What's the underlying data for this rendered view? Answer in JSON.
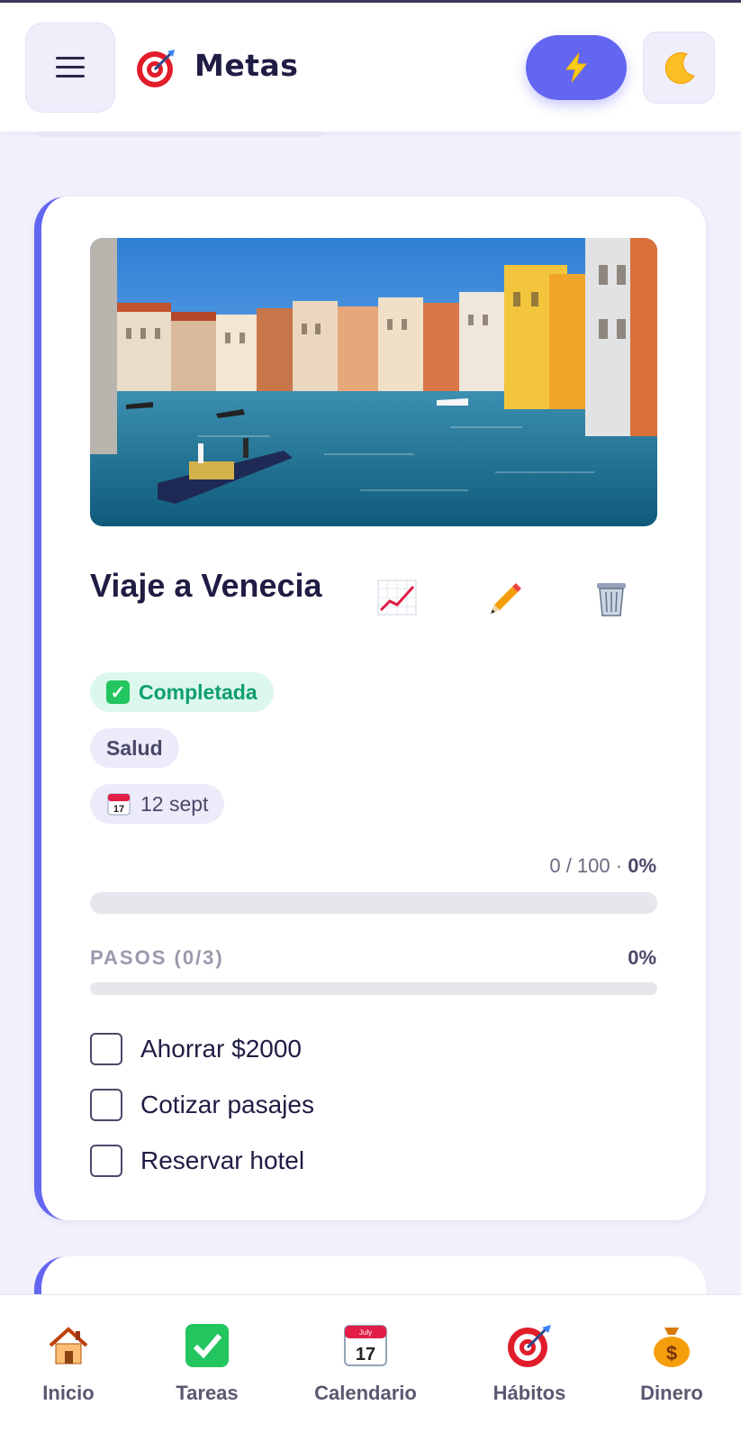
{
  "app": {
    "title": "Metas"
  },
  "header": {
    "menu_icon": "hamburger-icon",
    "logo_icon": "target-icon",
    "quick_icon": "lightning-icon",
    "theme_icon": "moon-icon"
  },
  "goal": {
    "title": "Viaje a Venecia",
    "image": "venice-canal-photo",
    "status": "Completada",
    "category": "Salud",
    "date": "12 sept",
    "progress_text": "0 / 100 · ",
    "progress_pct": "0%",
    "progress_value": 0,
    "steps_label": "PASOS (0/3)",
    "steps_pct": "0%",
    "steps_value": 0,
    "steps": [
      {
        "label": "Ahorrar $2000",
        "done": false
      },
      {
        "label": "Cotizar pasajes",
        "done": false
      },
      {
        "label": "Reservar hotel",
        "done": false
      }
    ],
    "actions": [
      "chart-icon",
      "pencil-icon",
      "trash-icon"
    ]
  },
  "nav": [
    {
      "label": "Inicio",
      "icon": "house-icon"
    },
    {
      "label": "Tareas",
      "icon": "check-icon"
    },
    {
      "label": "Calendario",
      "icon": "calendar-icon"
    },
    {
      "label": "Hábitos",
      "icon": "target-icon"
    },
    {
      "label": "Dinero",
      "icon": "money-bag-icon"
    }
  ],
  "colors": {
    "accent": "#6366f1",
    "success": "#0f9f6e",
    "background": "#f1f0fb"
  }
}
